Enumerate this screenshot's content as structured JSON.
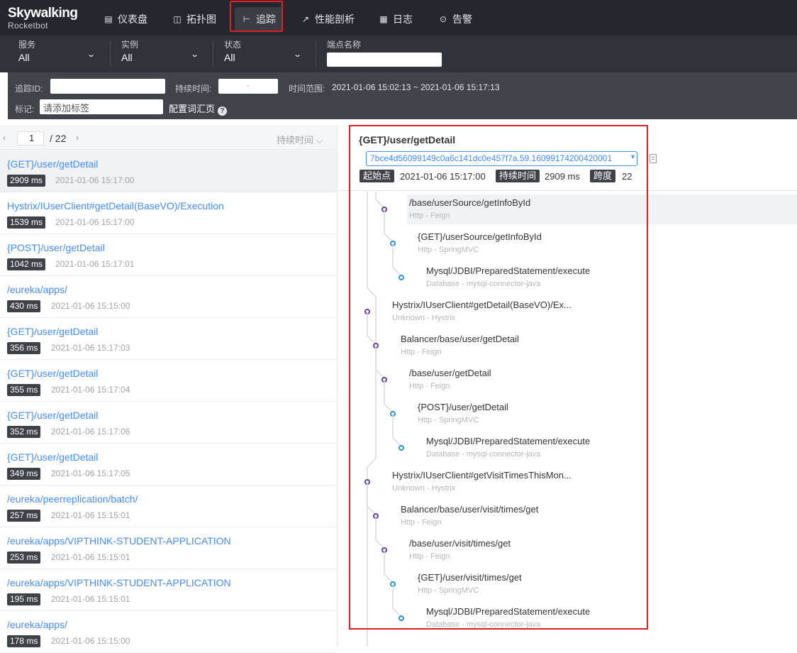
{
  "brand": {
    "line1": "Skywalking",
    "line2": "Rocketbot"
  },
  "nav": [
    {
      "label": "仪表盘",
      "icon": "dashboard-icon",
      "glyph": "▤"
    },
    {
      "label": "拓扑图",
      "icon": "topology-icon",
      "glyph": "◫"
    },
    {
      "label": "追踪",
      "icon": "trace-icon",
      "glyph": "⊢"
    },
    {
      "label": "性能剖析",
      "icon": "profile-icon",
      "glyph": "↗"
    },
    {
      "label": "日志",
      "icon": "log-icon",
      "glyph": "▦"
    },
    {
      "label": "告警",
      "icon": "alarm-icon",
      "glyph": "⊙"
    }
  ],
  "filters": {
    "service": {
      "label": "服务",
      "value": "All"
    },
    "instance": {
      "label": "实例",
      "value": "All"
    },
    "status": {
      "label": "状态",
      "value": "All"
    },
    "endpoint": {
      "label": "端点名称",
      "value": ""
    }
  },
  "search": {
    "trace_id_label": "追踪ID:",
    "duration_label": "持续时间:",
    "duration_sep": "-",
    "time_range_label": "时间范围:",
    "time_range_value": "2021-01-06 15:02:13 ~ 2021-01-06 15:17:13",
    "tags_label": "标记:",
    "tags_placeholder": "请添加标签",
    "config_link": "配置词汇页"
  },
  "pager": {
    "current": "1",
    "total": "/ 22",
    "sort": "持续时间 ⌵"
  },
  "traces": [
    {
      "name": "{GET}/user/getDetail",
      "duration": "2909 ms",
      "time": "2021-01-06 15:17:00"
    },
    {
      "name": "Hystrix/IUserClient#getDetail(BaseVO)/Execution",
      "duration": "1539 ms",
      "time": "2021-01-06 15:17:00"
    },
    {
      "name": "{POST}/user/getDetail",
      "duration": "1042 ms",
      "time": "2021-01-06 15:17:01"
    },
    {
      "name": "/eureka/apps/",
      "duration": "430 ms",
      "time": "2021-01-06 15:15:00"
    },
    {
      "name": "{GET}/user/getDetail",
      "duration": "356 ms",
      "time": "2021-01-06 15:17:03"
    },
    {
      "name": "{GET}/user/getDetail",
      "duration": "355 ms",
      "time": "2021-01-06 15:17:04"
    },
    {
      "name": "{GET}/user/getDetail",
      "duration": "352 ms",
      "time": "2021-01-06 15:17:06"
    },
    {
      "name": "{GET}/user/getDetail",
      "duration": "349 ms",
      "time": "2021-01-06 15:17:05"
    },
    {
      "name": "/eureka/peerreplication/batch/",
      "duration": "257 ms",
      "time": "2021-01-06 15:15:01"
    },
    {
      "name": "/eureka/apps/VIPTHINK-STUDENT-APPLICATION",
      "duration": "253 ms",
      "time": "2021-01-06 15:15:01"
    },
    {
      "name": "/eureka/apps/VIPTHINK-STUDENT-APPLICATION",
      "duration": "195 ms",
      "time": "2021-01-06 15:15:01"
    },
    {
      "name": "/eureka/apps/",
      "duration": "178 ms",
      "time": "2021-01-06 15:15:00"
    }
  ],
  "detail": {
    "title": "{GET}/user/getDetail",
    "trace_id": "7bce4d56099149c0a6c141dc0e457f7a.59.16099174200420001",
    "start_label": "起始点",
    "start_value": "2021-01-06 15:17:00",
    "duration_label": "持续时间",
    "duration_value": "2909 ms",
    "span_label": "跨度",
    "span_value": "22"
  },
  "colors": {
    "feign": "#6b3fa0",
    "springmvc": "#2a93d8",
    "link": "#448dfe"
  },
  "spans": [
    {
      "depth": 3,
      "title": "/base/userSource/getInfoById",
      "sub": "Http - Feign",
      "kind": "feign"
    },
    {
      "depth": 4,
      "title": "{GET}/userSource/getInfoById",
      "sub": "Http - SpringMVC",
      "kind": "springmvc"
    },
    {
      "depth": 5,
      "title": "Mysql/JDBI/PreparedStatement/execute",
      "sub": "Database - mysql-connector-java",
      "kind": "springmvc"
    },
    {
      "depth": 1,
      "title": "Hystrix/IUserClient#getDetail(BaseVO)/Ex...",
      "sub": "Unknown - Hystrix",
      "kind": "feign"
    },
    {
      "depth": 2,
      "title": "Balancer/base/user/getDetail",
      "sub": "Http - Feign",
      "kind": "feign"
    },
    {
      "depth": 3,
      "title": "/base/user/getDetail",
      "sub": "Http - Feign",
      "kind": "feign"
    },
    {
      "depth": 4,
      "title": "{POST}/user/getDetail",
      "sub": "Http - SpringMVC",
      "kind": "springmvc"
    },
    {
      "depth": 5,
      "title": "Mysql/JDBI/PreparedStatement/execute",
      "sub": "Database - mysql-connector-java",
      "kind": "springmvc"
    },
    {
      "depth": 1,
      "title": "Hystrix/IUserClient#getVisitTimesThisMon...",
      "sub": "Unknown - Hystrix",
      "kind": "feign"
    },
    {
      "depth": 2,
      "title": "Balancer/base/user/visit/times/get",
      "sub": "Http - Feign",
      "kind": "feign"
    },
    {
      "depth": 3,
      "title": "/base/user/visit/times/get",
      "sub": "Http - Feign",
      "kind": "feign"
    },
    {
      "depth": 4,
      "title": "{GET}/user/visit/times/get",
      "sub": "Http - SpringMVC",
      "kind": "springmvc"
    },
    {
      "depth": 5,
      "title": "Mysql/JDBI/PreparedStatement/execute",
      "sub": "Database - mysql-connector-java",
      "kind": "springmvc"
    }
  ]
}
